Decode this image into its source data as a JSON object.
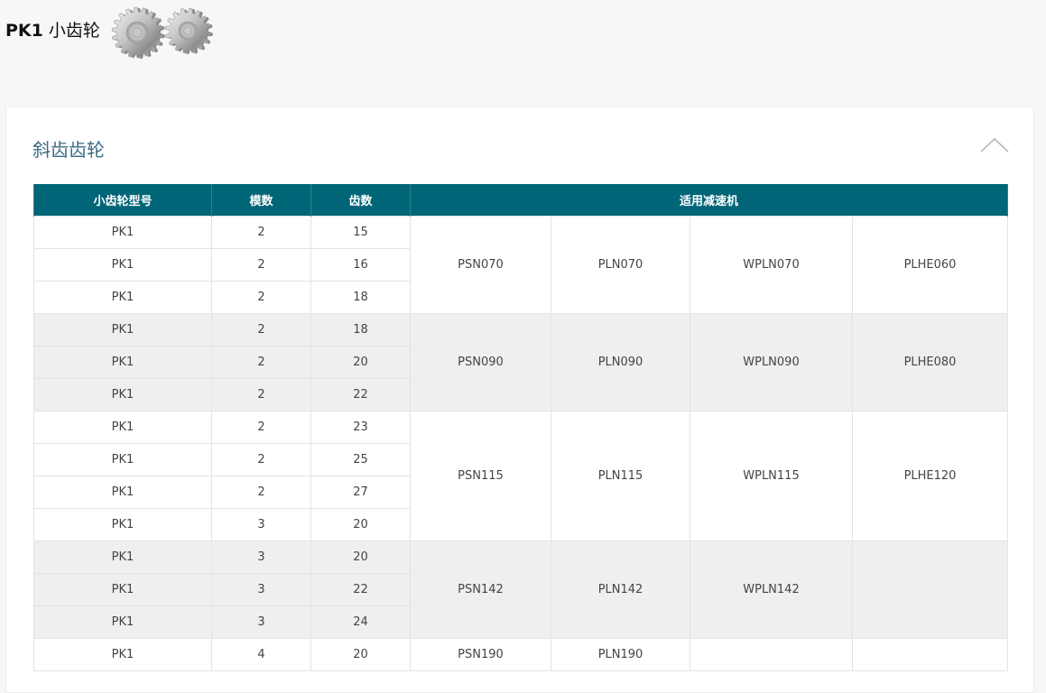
{
  "header": {
    "title_bold": "PK1",
    "title_rest": "小齿轮"
  },
  "section": {
    "title": "斜齿齿轮"
  },
  "table": {
    "headers": [
      "小齿轮型号",
      "模数",
      "齿数",
      "适用减速机"
    ],
    "groups": [
      {
        "rows": [
          [
            "PK1",
            "2",
            "15"
          ],
          [
            "PK1",
            "2",
            "16"
          ],
          [
            "PK1",
            "2",
            "18"
          ]
        ],
        "reducers": [
          "PSN070",
          "PLN070",
          "WPLN070",
          "PLHE060"
        ]
      },
      {
        "rows": [
          [
            "PK1",
            "2",
            "18"
          ],
          [
            "PK1",
            "2",
            "20"
          ],
          [
            "PK1",
            "2",
            "22"
          ]
        ],
        "reducers": [
          "PSN090",
          "PLN090",
          "WPLN090",
          "PLHE080"
        ]
      },
      {
        "rows": [
          [
            "PK1",
            "2",
            "23"
          ],
          [
            "PK1",
            "2",
            "25"
          ],
          [
            "PK1",
            "2",
            "27"
          ],
          [
            "PK1",
            "3",
            "20"
          ]
        ],
        "reducers": [
          "PSN115",
          "PLN115",
          "WPLN115",
          "PLHE120"
        ]
      },
      {
        "rows": [
          [
            "PK1",
            "3",
            "20"
          ],
          [
            "PK1",
            "3",
            "22"
          ],
          [
            "PK1",
            "3",
            "24"
          ]
        ],
        "reducers": [
          "PSN142",
          "PLN142",
          "WPLN142",
          ""
        ]
      },
      {
        "rows": [
          [
            "PK1",
            "4",
            "20"
          ]
        ],
        "reducers": [
          "PSN190",
          "PLN190",
          "",
          ""
        ]
      }
    ]
  },
  "colors": {
    "header_bg": "#006577",
    "section_title": "#3b6b86",
    "row_gray": "#efefef"
  },
  "icons": {
    "gears": "helical-gears-image",
    "collapse": "chevron-up-icon"
  }
}
